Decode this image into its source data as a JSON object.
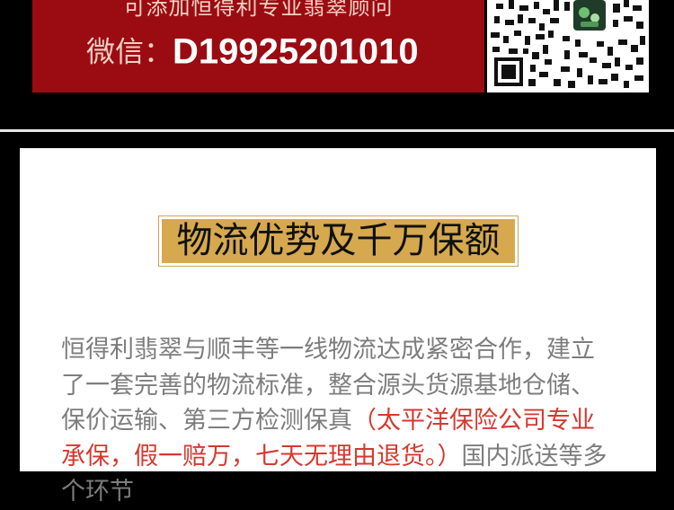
{
  "banner": {
    "line1": "可添加恒得利专业翡翠顾问",
    "wechat_label": "微信：",
    "wechat_id": "D19925201010",
    "background": "#9b0c12"
  },
  "qr": {
    "icon": "qr-code-icon",
    "logo_icon": "jade-logo-icon"
  },
  "section": {
    "title": "物流优势及千万保额",
    "title_color": "#d6a94f",
    "paragraph_part1": "恒得利翡翠与顺丰等一线物流达成紧密合作，建立了一套完善的物流标准，整合源头货源基地仓储、保价运输、第三方检测保真",
    "paragraph_highlight": "（太平洋保险公司专业承保，假一赔万，七天无理由退货。）",
    "paragraph_part2": "国内派送等多个环节",
    "highlight_color": "#d6382f"
  }
}
